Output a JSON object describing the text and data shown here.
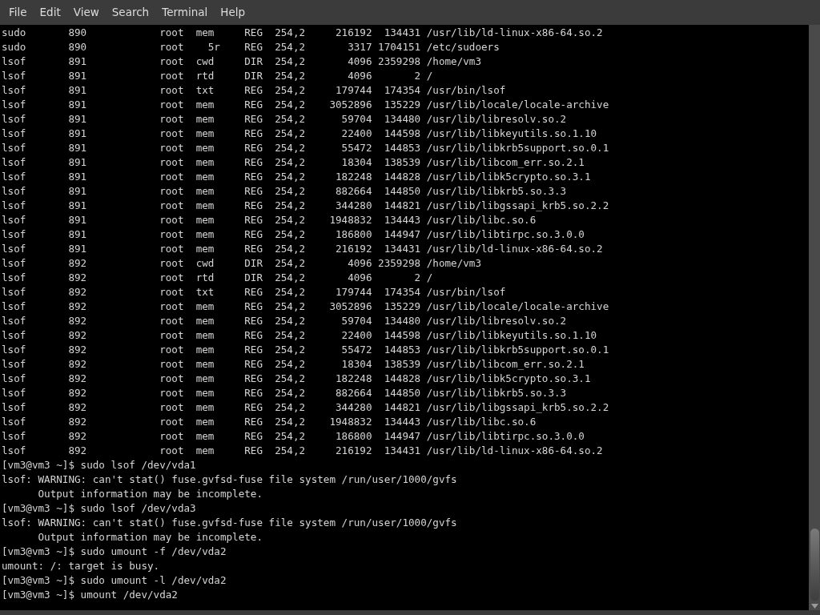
{
  "menu_bar": [
    "File",
    "Edit",
    "View",
    "Search",
    "Terminal",
    "Help"
  ],
  "terminal": {
    "lines": [
      "sudo       890            root  mem     REG  254,2     216192  134431 /usr/lib/ld-linux-x86-64.so.2",
      "sudo       890            root    5r    REG  254,2       3317 1704151 /etc/sudoers",
      "lsof       891            root  cwd     DIR  254,2       4096 2359298 /home/vm3",
      "lsof       891            root  rtd     DIR  254,2       4096       2 /",
      "lsof       891            root  txt     REG  254,2     179744  174354 /usr/bin/lsof",
      "lsof       891            root  mem     REG  254,2    3052896  135229 /usr/lib/locale/locale-archive",
      "lsof       891            root  mem     REG  254,2      59704  134480 /usr/lib/libresolv.so.2",
      "lsof       891            root  mem     REG  254,2      22400  144598 /usr/lib/libkeyutils.so.1.10",
      "lsof       891            root  mem     REG  254,2      55472  144853 /usr/lib/libkrb5support.so.0.1",
      "lsof       891            root  mem     REG  254,2      18304  138539 /usr/lib/libcom_err.so.2.1",
      "lsof       891            root  mem     REG  254,2     182248  144828 /usr/lib/libk5crypto.so.3.1",
      "lsof       891            root  mem     REG  254,2     882664  144850 /usr/lib/libkrb5.so.3.3",
      "lsof       891            root  mem     REG  254,2     344280  144821 /usr/lib/libgssapi_krb5.so.2.2",
      "lsof       891            root  mem     REG  254,2    1948832  134443 /usr/lib/libc.so.6",
      "lsof       891            root  mem     REG  254,2     186800  144947 /usr/lib/libtirpc.so.3.0.0",
      "lsof       891            root  mem     REG  254,2     216192  134431 /usr/lib/ld-linux-x86-64.so.2",
      "lsof       892            root  cwd     DIR  254,2       4096 2359298 /home/vm3",
      "lsof       892            root  rtd     DIR  254,2       4096       2 /",
      "lsof       892            root  txt     REG  254,2     179744  174354 /usr/bin/lsof",
      "lsof       892            root  mem     REG  254,2    3052896  135229 /usr/lib/locale/locale-archive",
      "lsof       892            root  mem     REG  254,2      59704  134480 /usr/lib/libresolv.so.2",
      "lsof       892            root  mem     REG  254,2      22400  144598 /usr/lib/libkeyutils.so.1.10",
      "lsof       892            root  mem     REG  254,2      55472  144853 /usr/lib/libkrb5support.so.0.1",
      "lsof       892            root  mem     REG  254,2      18304  138539 /usr/lib/libcom_err.so.2.1",
      "lsof       892            root  mem     REG  254,2     182248  144828 /usr/lib/libk5crypto.so.3.1",
      "lsof       892            root  mem     REG  254,2     882664  144850 /usr/lib/libkrb5.so.3.3",
      "lsof       892            root  mem     REG  254,2     344280  144821 /usr/lib/libgssapi_krb5.so.2.2",
      "lsof       892            root  mem     REG  254,2    1948832  134443 /usr/lib/libc.so.6",
      "lsof       892            root  mem     REG  254,2     186800  144947 /usr/lib/libtirpc.so.3.0.0",
      "lsof       892            root  mem     REG  254,2     216192  134431 /usr/lib/ld-linux-x86-64.so.2",
      "[vm3@vm3 ~]$ sudo lsof /dev/vda1",
      "lsof: WARNING: can't stat() fuse.gvfsd-fuse file system /run/user/1000/gvfs",
      "      Output information may be incomplete.",
      "[vm3@vm3 ~]$ sudo lsof /dev/vda3",
      "lsof: WARNING: can't stat() fuse.gvfsd-fuse file system /run/user/1000/gvfs",
      "      Output information may be incomplete.",
      "[vm3@vm3 ~]$ sudo umount -f /dev/vda2",
      "umount: /: target is busy.",
      "[vm3@vm3 ~]$ sudo umount -l /dev/vda2",
      "[vm3@vm3 ~]$ umount /dev/vda2"
    ]
  }
}
